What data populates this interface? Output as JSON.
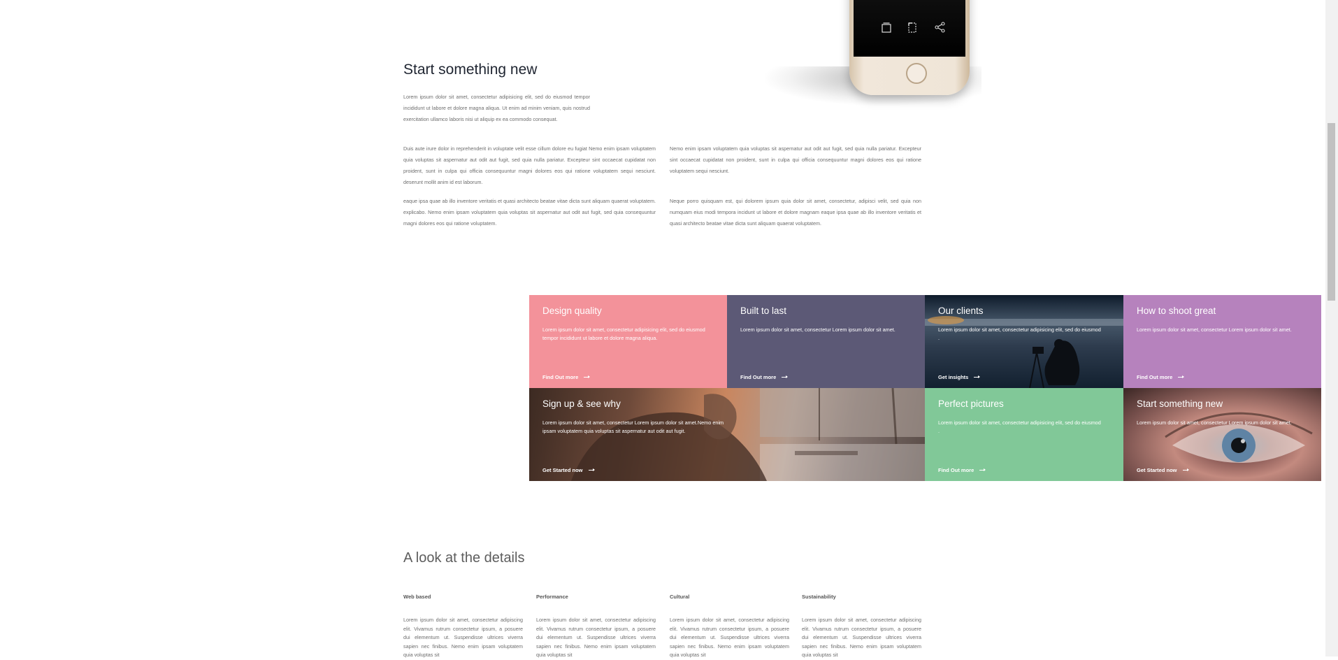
{
  "intro": {
    "title": "Start something new",
    "lead": "Lorem ipsum dolor sit amet, consectetur adipisicing elit, sed do eiusmod tempor incididunt ut labore et dolore magna aliqua. Ut enim ad minim veniam, quis nostrud exercitation ullamco laboris nisi ut aliquip ex ea commodo consequat.",
    "left_para_1": "Duis aute irure dolor in reprehenderit in voluptate velit esse cillum dolore eu fugiat Nemo enim ipsam voluptatem quia voluptas sit aspernatur aut odit aut fugit, sed quia nulla pariatur. Excepteur sint occaecat cupidatat non proident, sunt in culpa qui officia consequuntur magni dolores eos qui ratione voluptatem sequi nesciunt. deserunt mollit anim id est laborum.",
    "left_para_2": "eaque ipsa quae ab illo inventore veritatis et quasi architecto beatae vitae dicta sunt aliquam quaerat voluptatem. explicabo. Nemo enim ipsam voluptatem quia voluptas sit aspernatur aut odit aut fugit, sed quia consequuntur magni dolores eos qui ratione voluptatem.",
    "right_para_1": "Nemo enim ipsam voluptatem quia voluptas sit aspernatur aut odit aut fugit, sed quia nulla pariatur. Excepteur sint occaecat cupidatat non proident, sunt in culpa qui officia consequuntur magni dolores eos qui ratione voluptatem sequi nesciunt.",
    "right_para_2": "Neque porro quisquam est, qui dolorem ipsum quia dolor sit amet, consectetur, adipisci velit, sed quia non numquam eius modi tempora incidunt ut labore et dolore magnam eaque ipsa quae ab illo inventore veritatis et quasi architecto beatae vitae dicta sunt aliquam quaerat voluptatem."
  },
  "phone": {
    "icons": [
      "layers-icon",
      "crop-icon",
      "share-icon"
    ]
  },
  "tiles": {
    "design": {
      "title": "Design quality",
      "text": "Lorem ipsum dolor sit amet, consectetur adipisicing elit, sed do eiusmod tempor incididunt ut labore et dolore magna aliqua.",
      "cta": "Find Out more",
      "color": "#f3929a"
    },
    "built": {
      "title": "Built to last",
      "text": "Lorem ipsum dolor sit amet, consectetur Lorem ipsum dolor sit amet.",
      "cta": "Find Out more",
      "color": "#5c5976"
    },
    "clients": {
      "title": "Our clients",
      "text": "Lorem ipsum dolor sit amet, consectetur adipisicing elit, sed do eiusmod .",
      "cta": "Get insights"
    },
    "shoot": {
      "title": "How to shoot great",
      "text": "Lorem ipsum dolor sit amet, consectetur Lorem ipsum dolor sit amet.",
      "cta": "Find Out more",
      "color": "#b682bd"
    },
    "signup": {
      "title": "Sign up & see why",
      "text": "Lorem ipsum dolor sit amet, consectetur Lorem ipsum dolor sit amet.Nemo enim ipsam voluptatem quia voluptas sit aspernatur aut odit aut fugit.",
      "cta": "Get Started now"
    },
    "perfect": {
      "title": "Perfect pictures",
      "text": "Lorem ipsum dolor sit amet, consectetur adipisicing elit, sed do eiusmod .",
      "cta": "Find Out more",
      "color": "#81c898"
    },
    "eye": {
      "title": "Start something new",
      "text": "Lorem ipsum dolor sit amet, consectetur Lorem ipsum dolor sit amet.",
      "cta": "Get Started now"
    }
  },
  "details": {
    "title": "A look at the details",
    "columns": [
      {
        "heading": "Web based",
        "text": "Lorem ipsum dolor sit amet, consectetur adipiscing elit. Vivamus rutrum consectetur ipsum, a posuere dui elementum ut. Suspendisse ultrices viverra sapien nec finibus. Nemo enim ipsam voluptatem quia voluptas sit"
      },
      {
        "heading": "Performance",
        "text": "Lorem ipsum dolor sit amet, consectetur adipiscing elit. Vivamus rutrum consectetur ipsum, a posuere dui elementum ut. Suspendisse ultrices viverra sapien nec finibus. Nemo enim ipsam voluptatem quia voluptas sit"
      },
      {
        "heading": "Cultural",
        "text": "Lorem ipsum dolor sit amet, consectetur adipiscing elit. Vivamus rutrum consectetur ipsum, a posuere dui elementum ut. Suspendisse ultrices viverra sapien nec finibus. Nemo enim ipsam voluptatem quia voluptas sit"
      },
      {
        "heading": "Sustainability",
        "text": "Lorem ipsum dolor sit amet, consectetur adipiscing elit. Vivamus rutrum consectetur ipsum, a posuere dui elementum ut. Suspendisse ultrices viverra sapien nec finibus. Nemo enim ipsam voluptatem quia voluptas sit"
      }
    ]
  }
}
